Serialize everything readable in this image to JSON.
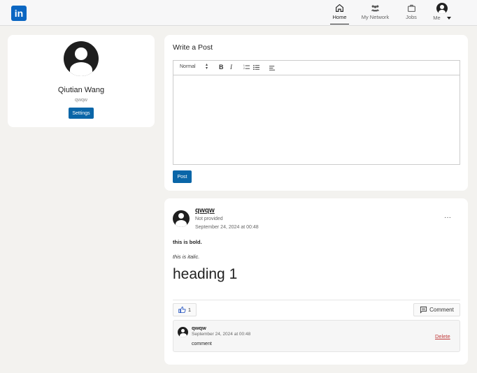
{
  "nav": {
    "logo": "in",
    "items": [
      {
        "label": "Home",
        "icon": "home-icon"
      },
      {
        "label": "My Network",
        "icon": "network-icon"
      },
      {
        "label": "Jobs",
        "icon": "briefcase-icon"
      },
      {
        "label": "Me",
        "icon": "avatar-icon"
      }
    ]
  },
  "profile": {
    "name": "Qiutian Wang",
    "handle": "qwqw",
    "settings_label": "Settings"
  },
  "composer": {
    "title": "Write a Post",
    "toolbar": {
      "format_select": "Normal",
      "bold": "B",
      "italic": "I"
    },
    "post_label": "Post"
  },
  "post": {
    "author": "qwqw",
    "subtitle": "Not provided",
    "timestamp": "September 24, 2024 at 00:48",
    "more": "···",
    "content": {
      "bold_line": "this is bold.",
      "italic_line": "this is italic.",
      "heading": "heading 1"
    },
    "like_count": "1",
    "comment_label": "Comment",
    "comments": [
      {
        "author": "qwqw",
        "timestamp": "September 24, 2024 at 00:48",
        "text": "comment",
        "delete_label": "Delete"
      }
    ]
  },
  "colors": {
    "brand": "#0a66c2",
    "button": "#0a66a8",
    "delete": "#c03a3a",
    "background": "#f3f2ef"
  }
}
